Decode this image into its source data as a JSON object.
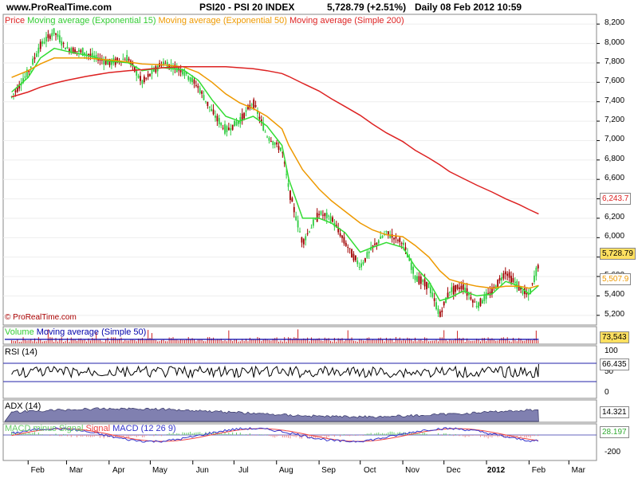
{
  "header": {
    "site": "www.ProRealTime.com",
    "instrument": "PSI20 - PSI 20 INDEX",
    "quote": "5,728.79 (+2.51%)",
    "period": "Daily  08 Feb 2012 10:59"
  },
  "legend": {
    "price": "Price",
    "ema15": "Moving average (Exponential 15)",
    "ema50": "Moving average (Exponential 50)",
    "sma200": "Moving average (Simple 200)"
  },
  "copyright": "© ProRealTime.com",
  "colors": {
    "up_bar": "#2ecc40",
    "down_bar": "#a00000",
    "ema15": "#33dd33",
    "ema50": "#ee9900",
    "sma200": "#dd2222",
    "volume_bar": "#cc2222",
    "volume_ma": "#0000aa",
    "rsi_line": "#000000",
    "rsi_levels": "#2222aa",
    "adx_fill": "#8080b0",
    "macd_line": "#3333cc",
    "signal_line": "#ee4444",
    "macd_hist_up": "#66cc66",
    "macd_hist_down": "#ee8888"
  },
  "panels": {
    "volume": {
      "label_a": "Volume",
      "label_b": "Moving average (Simple 50)",
      "value": "73,543"
    },
    "rsi": {
      "label": "RSI (14)",
      "value": "66.435",
      "ticks": [
        "100",
        "50",
        "0"
      ]
    },
    "adx": {
      "label": "ADX (14)",
      "value": "14.321"
    },
    "macd": {
      "label_a": "MACD minus Signal",
      "label_b": "Signal",
      "label_c": "MACD (12 26 9)",
      "value": "28.197",
      "ticks": [
        "-200"
      ]
    }
  },
  "price_axis": {
    "ticks": [
      "8,200",
      "8,000",
      "7,800",
      "7,600",
      "7,400",
      "7,200",
      "7,000",
      "6,800",
      "6,600",
      "6,400",
      "6,200",
      "6,000",
      "5,800",
      "5,600",
      "5,400",
      "5,200"
    ],
    "labels": {
      "sma200": "6,243.7",
      "price": "5,728.79",
      "ema50": "5,507.9"
    }
  },
  "x_axis": {
    "ticks": [
      "Feb",
      "Mar",
      "Apr",
      "May",
      "Jun",
      "Jul",
      "Aug",
      "Sep",
      "Oct",
      "Nov",
      "Dec",
      "2012",
      "Feb",
      "Mar"
    ]
  },
  "chart_data": {
    "type": "line",
    "title": "PSI20 - PSI 20 INDEX",
    "ylim": [
      5100,
      8300
    ],
    "x": [
      "2011-01-20",
      "2011-02-01",
      "2011-02-10",
      "2011-02-20",
      "2011-03-01",
      "2011-03-15",
      "2011-04-01",
      "2011-04-15",
      "2011-04-25",
      "2011-05-10",
      "2011-05-25",
      "2011-06-05",
      "2011-06-15",
      "2011-06-25",
      "2011-07-05",
      "2011-07-15",
      "2011-07-25",
      "2011-08-05",
      "2011-08-10",
      "2011-08-20",
      "2011-09-01",
      "2011-09-10",
      "2011-09-20",
      "2011-10-01",
      "2011-10-10",
      "2011-10-20",
      "2011-11-01",
      "2011-11-10",
      "2011-11-20",
      "2011-11-28",
      "2011-12-05",
      "2011-12-15",
      "2011-12-25",
      "2012-01-05",
      "2012-01-15",
      "2012-01-25",
      "2012-02-01",
      "2012-02-08"
    ],
    "series": [
      {
        "name": "Price",
        "values": [
          7450,
          7700,
          7980,
          8120,
          7950,
          7900,
          7800,
          7850,
          7600,
          7800,
          7720,
          7550,
          7300,
          7100,
          7200,
          7400,
          7050,
          6900,
          6500,
          5950,
          6250,
          6200,
          5950,
          5700,
          5900,
          6050,
          5950,
          5600,
          5500,
          5200,
          5450,
          5500,
          5300,
          5450,
          5650,
          5480,
          5400,
          5729
        ]
      },
      {
        "name": "Moving average (Exponential 15)",
        "values": [
          7500,
          7650,
          7850,
          7950,
          7920,
          7880,
          7820,
          7800,
          7720,
          7750,
          7730,
          7620,
          7420,
          7250,
          7200,
          7250,
          7150,
          6950,
          6600,
          6200,
          6200,
          6150,
          6050,
          5850,
          5900,
          5950,
          5900,
          5700,
          5550,
          5350,
          5380,
          5450,
          5400,
          5420,
          5550,
          5500,
          5420,
          5507
        ]
      },
      {
        "name": "Moving average (Exponential 50)",
        "values": [
          7650,
          7720,
          7790,
          7850,
          7850,
          7850,
          7830,
          7810,
          7790,
          7780,
          7760,
          7700,
          7600,
          7480,
          7390,
          7330,
          7250,
          7120,
          6950,
          6700,
          6500,
          6380,
          6270,
          6150,
          6080,
          6030,
          6010,
          5920,
          5800,
          5660,
          5570,
          5530,
          5500,
          5480,
          5500,
          5500,
          5480,
          5508
        ]
      },
      {
        "name": "Moving average (Simple 200)",
        "values": [
          7450,
          7500,
          7550,
          7590,
          7620,
          7660,
          7700,
          7720,
          7730,
          7750,
          7760,
          7760,
          7760,
          7760,
          7750,
          7740,
          7720,
          7690,
          7660,
          7590,
          7510,
          7430,
          7350,
          7260,
          7170,
          7080,
          6990,
          6900,
          6820,
          6750,
          6680,
          6610,
          6540,
          6470,
          6400,
          6340,
          6290,
          6244
        ]
      }
    ]
  }
}
